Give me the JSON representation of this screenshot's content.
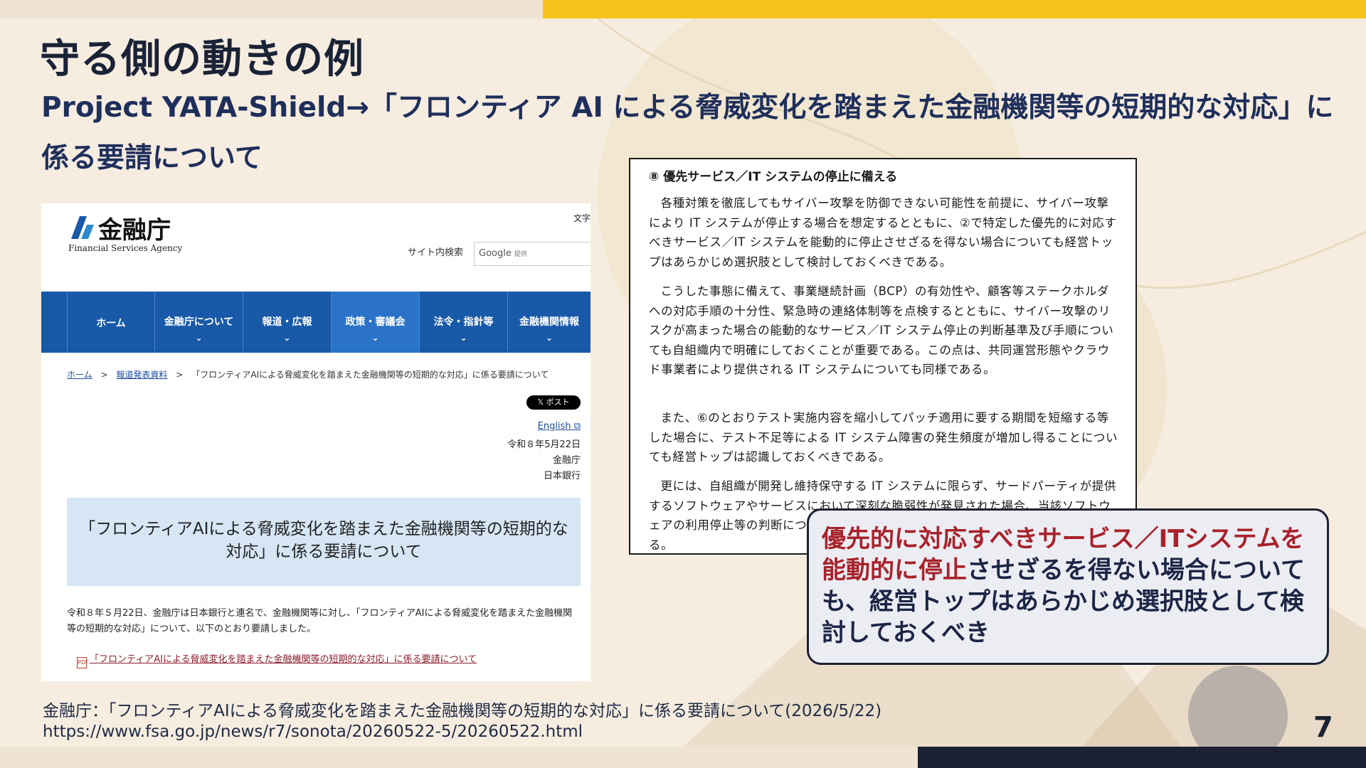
{
  "slide": {
    "title": "守る側の動きの例",
    "subtitle": "Project YATA-Shield→「フロンティア AI による脅威変化を踏まえた金融機関等の短期的な対応」に係る要請について",
    "page_number": "7"
  },
  "website": {
    "logo_text": "金融庁",
    "logo_en": "Financial Services Agency",
    "font_size_label": "文字",
    "search_label": "サイト内検索",
    "search_placeholder": "Google",
    "search_provided": "提供",
    "nav": [
      {
        "label": "ホーム"
      },
      {
        "label": "金融庁について"
      },
      {
        "label": "報道・広報"
      },
      {
        "label": "政策・審議会"
      },
      {
        "label": "法令・指針等"
      },
      {
        "label": "金融機関情報"
      }
    ],
    "breadcrumb": {
      "home": "ホーム",
      "press": "報道発表資料",
      "current": "「フロンティアAIによる脅威変化を踏まえた金融機関等の短期的な対応」に係る要請について",
      "separator": ">"
    },
    "x_post_label": "𝕏 ポスト",
    "english_link": "English",
    "date": "令和８年5月22日",
    "issuer_1": "金融庁",
    "issuer_2": "日本銀行",
    "release_title": "「フロンティアAIによる脅威変化を踏まえた金融機関等の短期的な対応」に係る要請について",
    "release_body": "令和８年５月22日、金融庁は日本銀行と連名で、金融機関等に対し、「フロンティアAIによる脅威変化を踏まえた金融機関等の短期的な対応」について、以下のとおり要請しました。",
    "pdf_link": "「フロンティアAIによる脅威変化を踏まえた金融機関等の短期的な対応」に係る要請について"
  },
  "document": {
    "heading": "⑧ 優先サービス／IT システムの停止に備える",
    "paragraphs": [
      "各種対策を徹底してもサイバー攻撃を防御できない可能性を前提に、サイバー攻撃により IT システムが停止する場合を想定するとともに、②で特定した優先的に対応すべきサービス／IT システムを能動的に停止させざるを得ない場合についても経営トップはあらかじめ選択肢として検討しておくべきである。",
      "こうした事態に備えて、事業継続計画（BCP）の有効性や、顧客等ステークホルダへの対応手順の十分性、緊急時の連絡体制等を点検するとともに、サイバー攻撃のリスクが高まった場合の能動的なサービス／IT システム停止の判断基準及び手順についても自組織内で明確にしておくことが重要である。この点は、共同運営形態やクラウド事業者により提供される IT システムについても同様である。",
      "また、⑥のとおりテスト実施内容を縮小してパッチ適用に要する期間を短縮する等した場合に、テスト不足等による IT システム障害の発生頻度が増加し得ることについても経営トップは認識しておくべきである。",
      "更には、自組織が開発し維持保守する IT システムに限らず、サードパーティが提供するソフトウェアやサービスにおいて深刻な脆弱性が発見された場合、当該ソフトウェアの利用停止等の判断についても、経営トップはあらかじめ検討しておくべきである。"
    ]
  },
  "callout": {
    "highlight": "優先的に対応すべきサービス／ITシステムを能動的に停止",
    "rest": "させざるを得ない場合についても、経営トップはあらかじめ選択肢として検討しておくべき"
  },
  "source": {
    "citation": "金融庁：「フロンティアAIによる脅威変化を踏まえた金融機関等の短期的な対応」に係る要請について(2026/5/22)",
    "url": "https://www.fsa.go.jp/news/r7/sonota/20260522-5/20260522.html"
  },
  "colors": {
    "accent_yellow": "#f7c21e",
    "nav_blue": "#1859a8",
    "highlight_red": "#a8222b",
    "navy": "#1c2233"
  }
}
